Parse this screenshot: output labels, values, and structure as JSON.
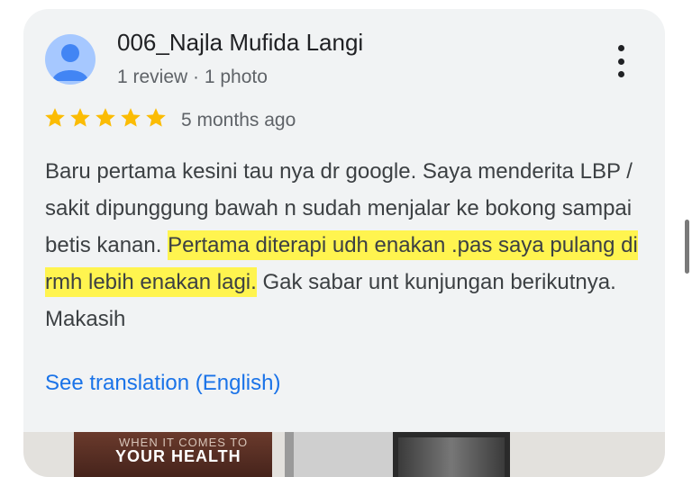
{
  "review": {
    "author": "006_Najla Mufida Langi",
    "author_meta": "1 review · 1 photo",
    "rating": 5,
    "max_rating": 5,
    "time_ago": "5 months ago",
    "text_part1": "Baru pertama kesini tau nya dr google. Saya menderita LBP / sakit dipunggung bawah n sudah menjalar ke bokong sampai betis kanan. ",
    "text_highlight": "Pertama diterapi udh enakan .pas saya pulang di rmh lebih enakan lagi.",
    "text_part2": " Gak sabar unt kunjungan berikutnya. Makasih",
    "translate_link": "See translation (English)"
  },
  "photo_strip": {
    "poster_line1": "WHEN IT COMES TO",
    "poster_line2": "YOUR HEALTH"
  },
  "icons": {
    "avatar": "person-icon",
    "menu": "more-vert-icon",
    "star": "star-icon"
  },
  "colors": {
    "card_bg": "#f1f3f4",
    "star": "#fbbc04",
    "highlight": "#fff44f",
    "link": "#1a73e8",
    "avatar_bg": "#a6c8ff",
    "avatar_fg": "#4285f4"
  }
}
